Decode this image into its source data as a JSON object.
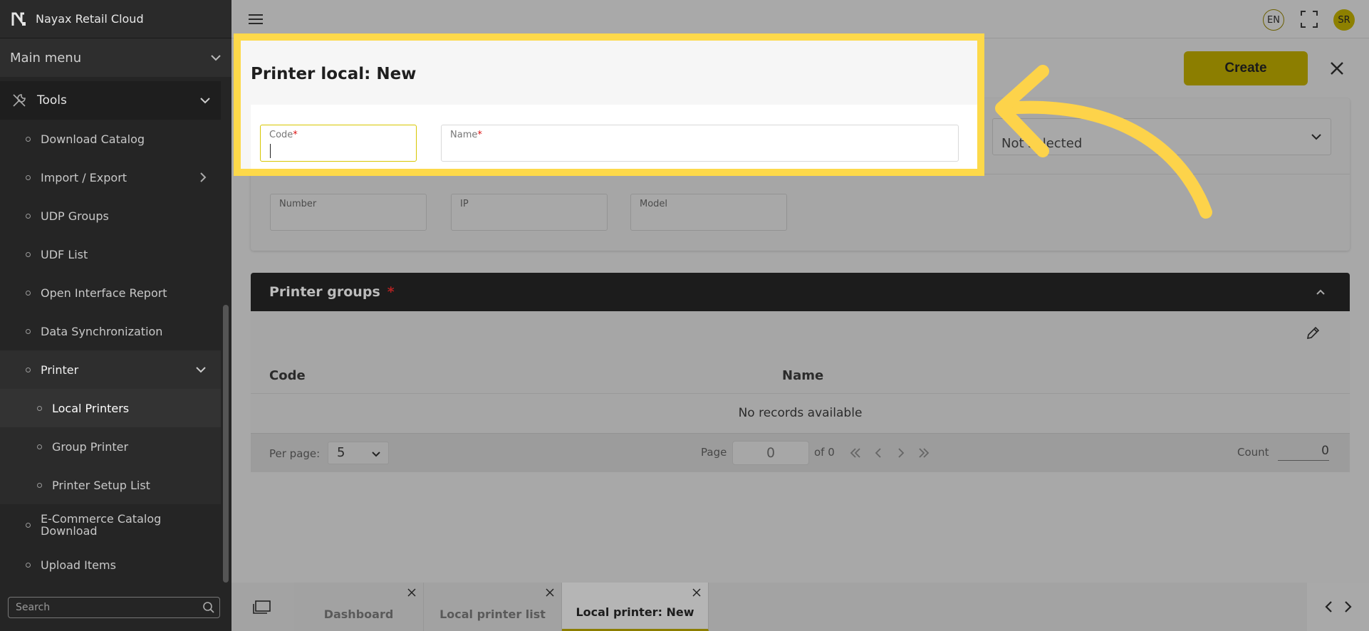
{
  "app": {
    "name": "Nayax Retail Cloud"
  },
  "sidebar": {
    "main_menu": "Main menu",
    "tools": "Tools",
    "items": [
      {
        "label": "Download Catalog"
      },
      {
        "label": "Import / Export"
      },
      {
        "label": "UDP Groups"
      },
      {
        "label": "UDF List"
      },
      {
        "label": "Open Interface Report"
      },
      {
        "label": "Data Synchronization"
      },
      {
        "label": "Printer"
      },
      {
        "label": "Local Printers"
      },
      {
        "label": "Group Printer"
      },
      {
        "label": "Printer Setup List"
      },
      {
        "label": "E-Commerce Catalog Download"
      },
      {
        "label": "Upload Items"
      }
    ],
    "search_placeholder": "Search"
  },
  "header": {
    "language": "EN",
    "user_initials": "SR"
  },
  "form": {
    "title": "Printer local: New",
    "create_label": "Create",
    "code_label": "Code",
    "name_label": "Name",
    "required_mark": "*",
    "status_value": "Not selected",
    "number_label": "Number",
    "ip_label": "IP",
    "model_label": "Model"
  },
  "printer_groups": {
    "title": "Printer groups",
    "required_mark": "*",
    "columns": [
      "Code",
      "Name"
    ],
    "empty_text": "No records available",
    "per_page_label": "Per page:",
    "per_page_value": "5",
    "page_label": "Page",
    "page_value": "0",
    "of_label": "of 0",
    "count_label": "Count",
    "count_value": "0"
  },
  "tabs": [
    {
      "label": "Dashboard"
    },
    {
      "label": "Local printer list"
    },
    {
      "label": "Local printer: New"
    }
  ],
  "colors": {
    "accent": "#fdd94a",
    "button": "#d4c000",
    "sidebar": "#252525"
  }
}
